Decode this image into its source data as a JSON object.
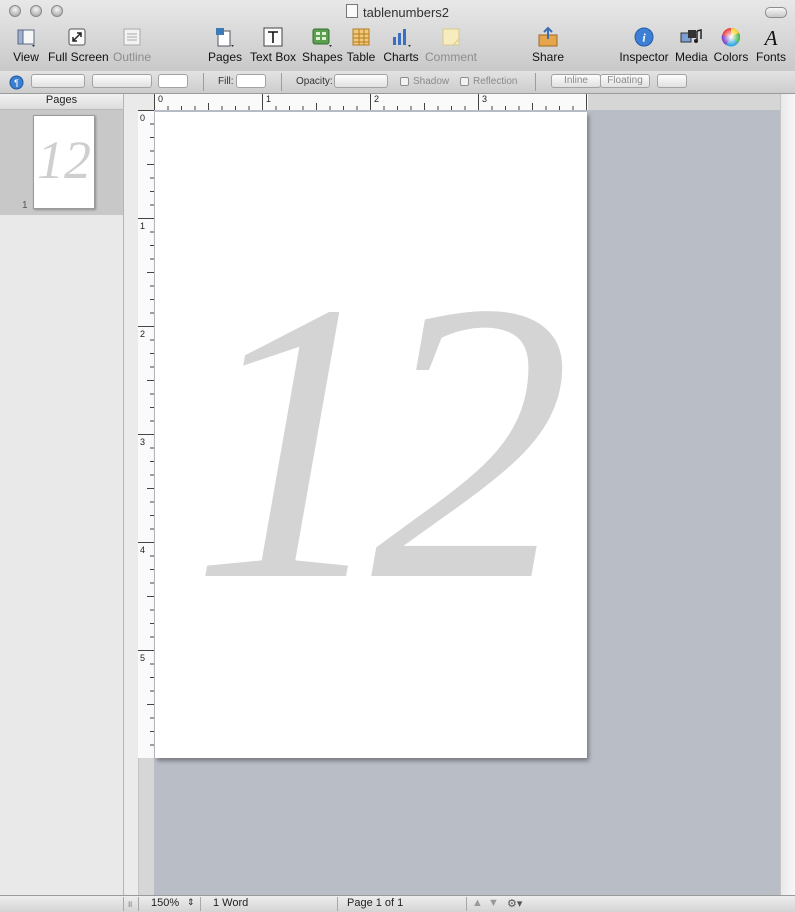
{
  "window": {
    "title": "tablenumbers2"
  },
  "toolbar": {
    "items": [
      {
        "label": "View"
      },
      {
        "label": "Full Screen"
      },
      {
        "label": "Outline"
      },
      {
        "label": "Pages"
      },
      {
        "label": "Text Box"
      },
      {
        "label": "Shapes"
      },
      {
        "label": "Table"
      },
      {
        "label": "Charts"
      },
      {
        "label": "Comment"
      },
      {
        "label": "Share"
      },
      {
        "label": "Inspector"
      },
      {
        "label": "Media"
      },
      {
        "label": "Colors"
      },
      {
        "label": "Fonts"
      }
    ]
  },
  "format_bar": {
    "fill_label": "Fill:",
    "opacity_label": "Opacity:",
    "shadow_label": "Shadow",
    "reflection_label": "Reflection",
    "inline_label": "Inline",
    "floating_label": "Floating"
  },
  "sidebar": {
    "header": "Pages",
    "thumbnails": [
      {
        "number": "1",
        "content": "12"
      }
    ]
  },
  "ruler": {
    "horizontal_labels": [
      "0",
      "1",
      "2",
      "3"
    ],
    "vertical_labels": [
      "0",
      "1",
      "2",
      "3",
      "4",
      "5"
    ]
  },
  "document": {
    "page_text": "12",
    "text_color": "#d4d4d4"
  },
  "status_bar": {
    "zoom": "150%",
    "word_count": "1 Word",
    "page_indicator": "Page 1 of 1"
  }
}
